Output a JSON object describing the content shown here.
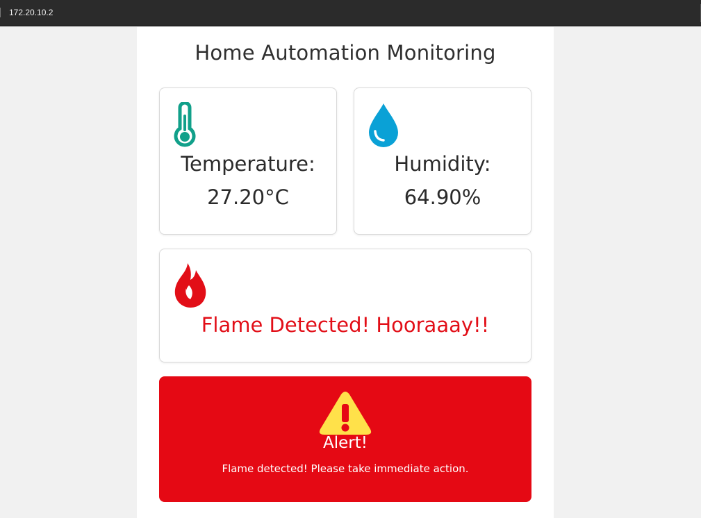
{
  "browser": {
    "address": "172.20.10.2"
  },
  "page": {
    "title": "Home Automation Monitoring"
  },
  "temperature": {
    "label": "Temperature:",
    "value": "27.20°C",
    "icon": "thermometer-icon",
    "color": "#11a08a"
  },
  "humidity": {
    "label": "Humidity:",
    "value": "64.90%",
    "icon": "water-drop-icon",
    "color": "#0aa1d6"
  },
  "flame": {
    "status": "Flame Detected! Hooraaay!!",
    "icon": "flame-icon",
    "color": "#e20e17"
  },
  "alert": {
    "title": "Alert!",
    "message": "Flame detected! Please take immediate action.",
    "icon": "warning-icon",
    "background": "#e50914",
    "icon_color": "#ffe14a"
  }
}
